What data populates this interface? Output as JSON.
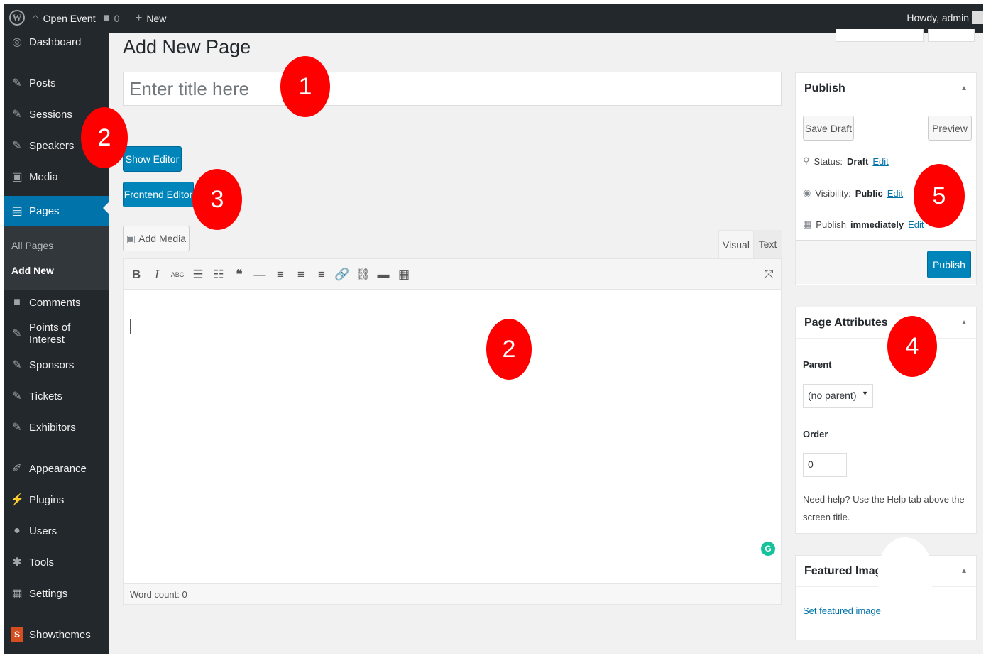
{
  "adminbar": {
    "site_name": "Open Event",
    "comments_count": "0",
    "new_label": "New",
    "greeting": "Howdy, admin"
  },
  "sidebar": {
    "items": [
      {
        "label": "Dashboard",
        "icon": "dashboard-icon"
      },
      {
        "label": "Posts",
        "icon": "pin-icon"
      },
      {
        "label": "Sessions",
        "icon": "pin-icon"
      },
      {
        "label": "Speakers",
        "icon": "pin-icon"
      },
      {
        "label": "Media",
        "icon": "media-icon"
      },
      {
        "label": "Pages",
        "icon": "pages-icon"
      },
      {
        "label": "Comments",
        "icon": "comment-icon"
      },
      {
        "label": "Points of Interest",
        "icon": "pin-icon"
      },
      {
        "label": "Sponsors",
        "icon": "pin-icon"
      },
      {
        "label": "Tickets",
        "icon": "pin-icon"
      },
      {
        "label": "Exhibitors",
        "icon": "pin-icon"
      },
      {
        "label": "Appearance",
        "icon": "brush-icon"
      },
      {
        "label": "Plugins",
        "icon": "plug-icon"
      },
      {
        "label": "Users",
        "icon": "user-icon"
      },
      {
        "label": "Tools",
        "icon": "wrench-icon"
      },
      {
        "label": "Settings",
        "icon": "settings-icon"
      },
      {
        "label": "Showthemes",
        "icon": "showthemes-icon"
      }
    ],
    "submenu": [
      "All Pages",
      "Add New"
    ]
  },
  "main": {
    "page_title": "Add New Page",
    "title_placeholder": "Enter title here",
    "show_editor": "Show Editor",
    "frontend_editor": "Frontend Editor",
    "add_media": "Add Media",
    "tab_visual": "Visual",
    "tab_text": "Text",
    "word_count": "Word count: 0"
  },
  "publish": {
    "title": "Publish",
    "save_draft": "Save Draft",
    "preview": "Preview",
    "status_label": "Status:",
    "status_value": "Draft",
    "visibility_label": "Visibility:",
    "visibility_value": "Public",
    "publish_label": "Publish",
    "publish_value": "immediately",
    "edit": "Edit",
    "publish_button": "Publish"
  },
  "page_attributes": {
    "title": "Page Attributes",
    "parent_label": "Parent",
    "parent_value": "(no parent)",
    "order_label": "Order",
    "order_value": "0",
    "help": "Need help? Use the Help tab above the screen title."
  },
  "featured_image": {
    "title": "Featured Image",
    "link": "Set featured image"
  },
  "annotations": {
    "one": "1",
    "two_sidebar": "2",
    "three": "3",
    "two_editor": "2",
    "four": "4",
    "five": "5"
  },
  "colors": {
    "admin_dark": "#23282d",
    "accent_blue": "#0073aa",
    "annotation_red": "#ff0000"
  }
}
